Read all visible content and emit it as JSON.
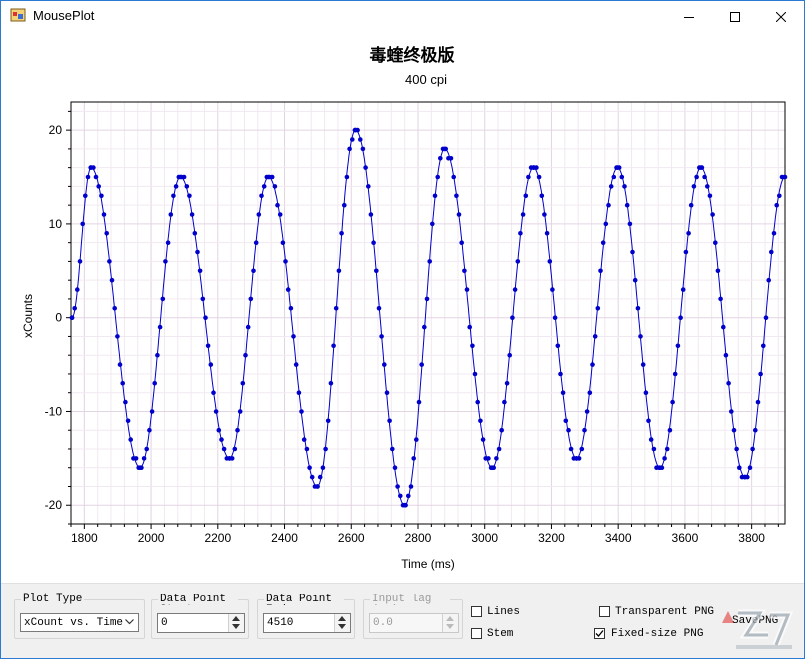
{
  "window": {
    "title": "MousePlot"
  },
  "chart_data": {
    "type": "line",
    "title": "毒蝰终极版",
    "subtitle": "400 cpi",
    "xlabel": "Time (ms)",
    "ylabel": "xCounts",
    "xlim": [
      1760,
      3900
    ],
    "ylim": [
      -22,
      23
    ],
    "xticks": [
      1800,
      2000,
      2200,
      2400,
      2600,
      2800,
      3000,
      3200,
      3400,
      3600,
      3800
    ],
    "yticks": [
      -20,
      -10,
      0,
      10,
      20
    ],
    "grid": true,
    "markers": true,
    "series": [
      {
        "color": "#0000cc",
        "sample_interval_ms": 8,
        "extrema": [
          {
            "x": 1763,
            "y": 0
          },
          {
            "x": 1820,
            "y": 16
          },
          {
            "x": 1967,
            "y": -16
          },
          {
            "x": 2088,
            "y": 15
          },
          {
            "x": 2235,
            "y": -15
          },
          {
            "x": 2352,
            "y": 15
          },
          {
            "x": 2498,
            "y": -18
          },
          {
            "x": 2613,
            "y": 20
          },
          {
            "x": 2760,
            "y": -20
          },
          {
            "x": 2880,
            "y": 18
          },
          {
            "x": 3022,
            "y": -16
          },
          {
            "x": 3146,
            "y": 16
          },
          {
            "x": 3275,
            "y": -15
          },
          {
            "x": 3398,
            "y": 16
          },
          {
            "x": 3525,
            "y": -16
          },
          {
            "x": 3648,
            "y": 16
          },
          {
            "x": 3780,
            "y": -17
          },
          {
            "x": 3900,
            "y": 15
          }
        ]
      }
    ]
  },
  "controls": {
    "plot_type": {
      "label": "Plot Type",
      "value": "xCount vs. Time"
    },
    "start": {
      "label": "Data Point Start",
      "value": "0"
    },
    "end": {
      "label": "Data Point End",
      "value": "4510"
    },
    "lag": {
      "label": "Input lag (ms)",
      "value": "0.0"
    },
    "lines_label": "Lines",
    "stem_label": "Stem",
    "transparent_label": "Transparent PNG",
    "fixed_label": "Fixed-size PNG",
    "save_label": "SavePNG"
  }
}
